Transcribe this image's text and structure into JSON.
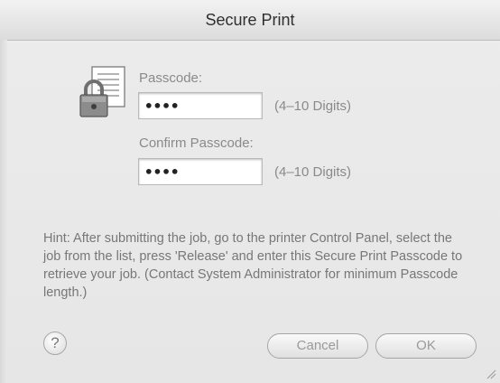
{
  "window": {
    "title": "Secure Print"
  },
  "passcode": {
    "label": "Passcode:",
    "value": "••••",
    "digits_hint": "(4–10 Digits)"
  },
  "confirm": {
    "label": "Confirm Passcode:",
    "value": "••••",
    "digits_hint": "(4–10 Digits)"
  },
  "hint": "Hint: After submitting the job, go to the printer Control Panel, select the job from the list, press 'Release' and enter this Secure Print Passcode to retrieve your job.  (Contact System Administrator for minimum Passcode length.)",
  "buttons": {
    "help": "?",
    "cancel": "Cancel",
    "ok": "OK"
  },
  "icons": [
    "lock-document-icon",
    "help-icon",
    "resize-grip-icon"
  ]
}
